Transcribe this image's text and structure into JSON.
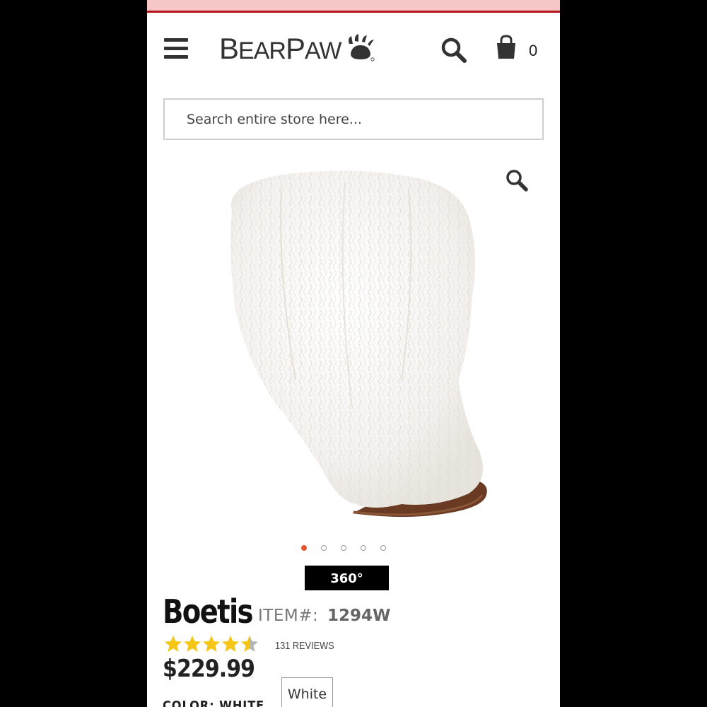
{
  "header": {
    "brand": "BEARPAW",
    "cart_count": "0"
  },
  "search": {
    "placeholder": "Search entire store here..."
  },
  "gallery": {
    "image_count": 5,
    "active_index": 0,
    "view_360_label": "360°"
  },
  "product": {
    "name": "Boetis",
    "item_label": "ITEM#:",
    "item_number": "1294W",
    "rating": 4.5,
    "rating_max": 5,
    "reviews_label": "131 REVIEWS",
    "price": "$229.99",
    "color_label": "COLOR: WHITE",
    "color_option": "White"
  },
  "colors": {
    "promo_bar": "#f7c6c6",
    "accent_red": "#b3121b",
    "star_gold": "#f5c518",
    "dot_active": "#e4572e"
  },
  "icons": [
    "hamburger-menu-icon",
    "paw-icon",
    "search-icon",
    "shopping-bag-icon",
    "zoom-icon",
    "star-icon"
  ]
}
